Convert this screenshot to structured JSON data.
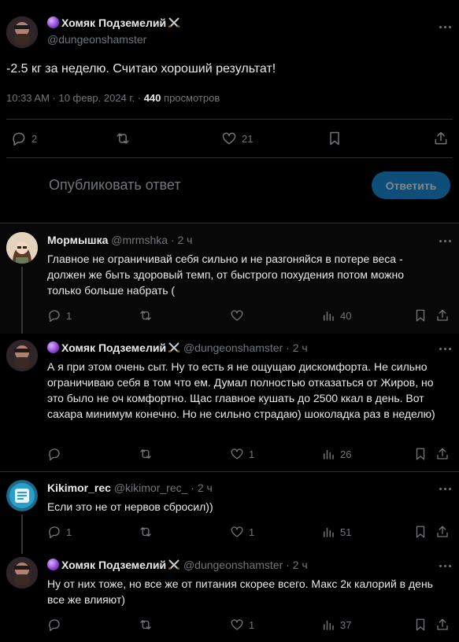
{
  "colors": {
    "background": "#000000",
    "text": "#e7e9ea",
    "muted": "#71767b",
    "accent": "#1d9bf0",
    "divider": "#2f3336"
  },
  "main_post": {
    "author_name": "Хомяк Подземелий",
    "handle": "@dungeonshamster",
    "text": "-2.5 кг за неделю. Считаю хороший результат!",
    "time": "10:33 AM · 10 февр. 2024 г. ·",
    "views_count": "440",
    "views_label": "просмотров",
    "replies": "2",
    "reposts": "",
    "likes": "21"
  },
  "composer": {
    "placeholder": "Опубликовать ответ",
    "reply_button": "Ответить"
  },
  "replies": [
    {
      "author_name": "Мормышка",
      "handle": "@mrmshka",
      "time": "· 2 ч",
      "text": "Главное не ограничивай себя сильно и не разгоняйся в потере веса - должен же быть здоровый темп, от быстрого похудения потом можно только больше набрать (",
      "replies": "1",
      "likes": "",
      "views": "40"
    },
    {
      "author_name": "Хомяк Подземелий",
      "handle": "@dungeonshamster",
      "time": "· 2 ч",
      "text": "А я при этом очень сыт. Ну то есть я не ощущаю дискомфорта. Не сильно ограничиваю себя в том что ем. Думал полностью отказаться от Жиров, но это было не оч комфортно. Щас главное кушать до 2500 ккал в день. Вот сахара минимум конечно. Но не сильно страдаю) шоколадка раз в неделю)",
      "replies": "",
      "likes": "1",
      "views": "26"
    },
    {
      "author_name": "Kikimor_rec",
      "handle": "@kikimor_rec_",
      "time": "· 2 ч",
      "text": "Если это не от нервов сбросил))",
      "replies": "1",
      "likes": "1",
      "views": "51"
    },
    {
      "author_name": "Хомяк Подземелий",
      "handle": "@dungeonshamster",
      "time": "· 2 ч",
      "text": "Ну от них тоже, но все же от питания скорее всего. Макс 2к калорий в день все же влияют)",
      "replies": "",
      "likes": "1",
      "views": "37"
    }
  ]
}
